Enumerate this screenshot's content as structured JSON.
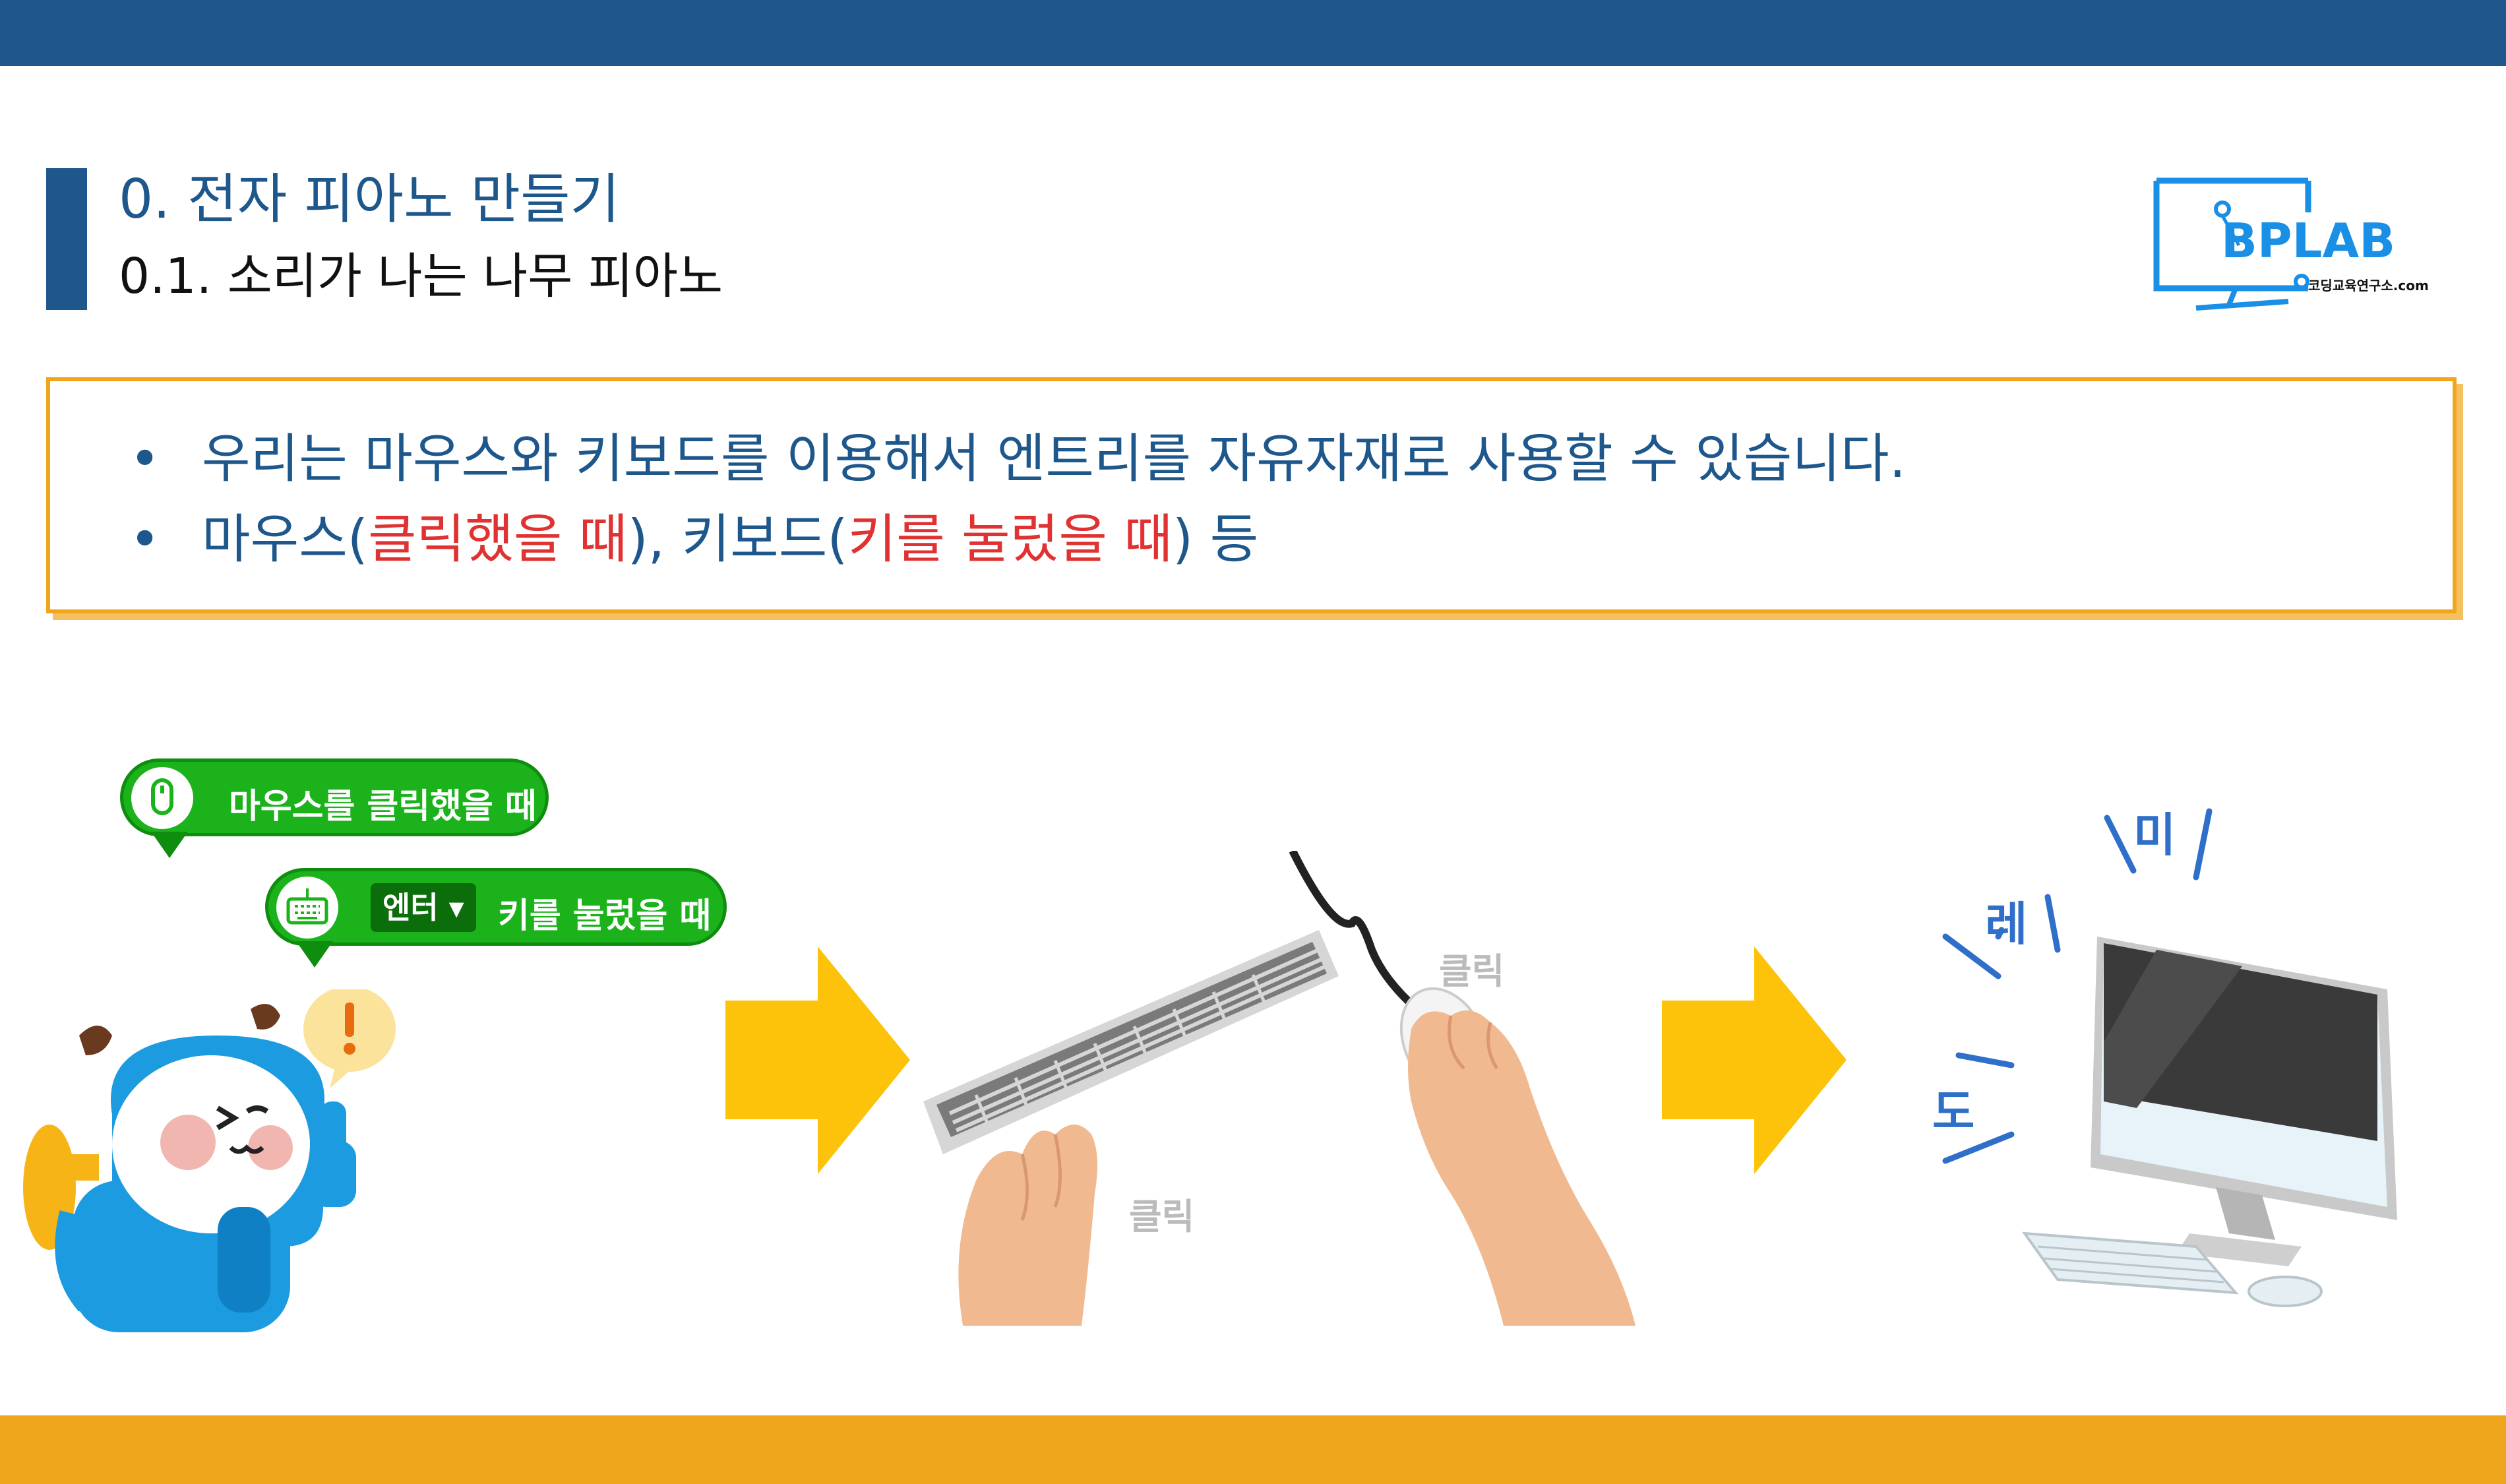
{
  "header": {
    "title": "0. 전자 피아노 만들기",
    "subtitle": "0.1. 소리가 나는 나무 피아노"
  },
  "logo": {
    "name": "BPLAB",
    "tagline": "코딩교육연구소.com"
  },
  "info": {
    "bullet_char": "•",
    "line1": "우리는 마우스와 키보드를 이용해서 엔트리를 자유자재로 사용할 수 있습니다.",
    "line2_parts": {
      "a": "마우스(",
      "b": "클릭했을 때",
      "c": "), 키보드(",
      "d": "키를 눌렀을 때",
      "e": ") 등"
    }
  },
  "blocks": {
    "mouse_block": "마우스를 클릭했을 때",
    "key_select": "엔터",
    "key_block": "키를 눌렀을 때"
  },
  "illustration": {
    "click_mouse": "클릭",
    "click_keyboard": "클릭",
    "notes": [
      "도",
      "레",
      "미"
    ]
  },
  "colors": {
    "primary_blue": "#1d578b",
    "accent_orange": "#efa61d",
    "arrow_yellow": "#fdc20a",
    "highlight_red": "#e03232",
    "block_green": "#1bb21b"
  }
}
